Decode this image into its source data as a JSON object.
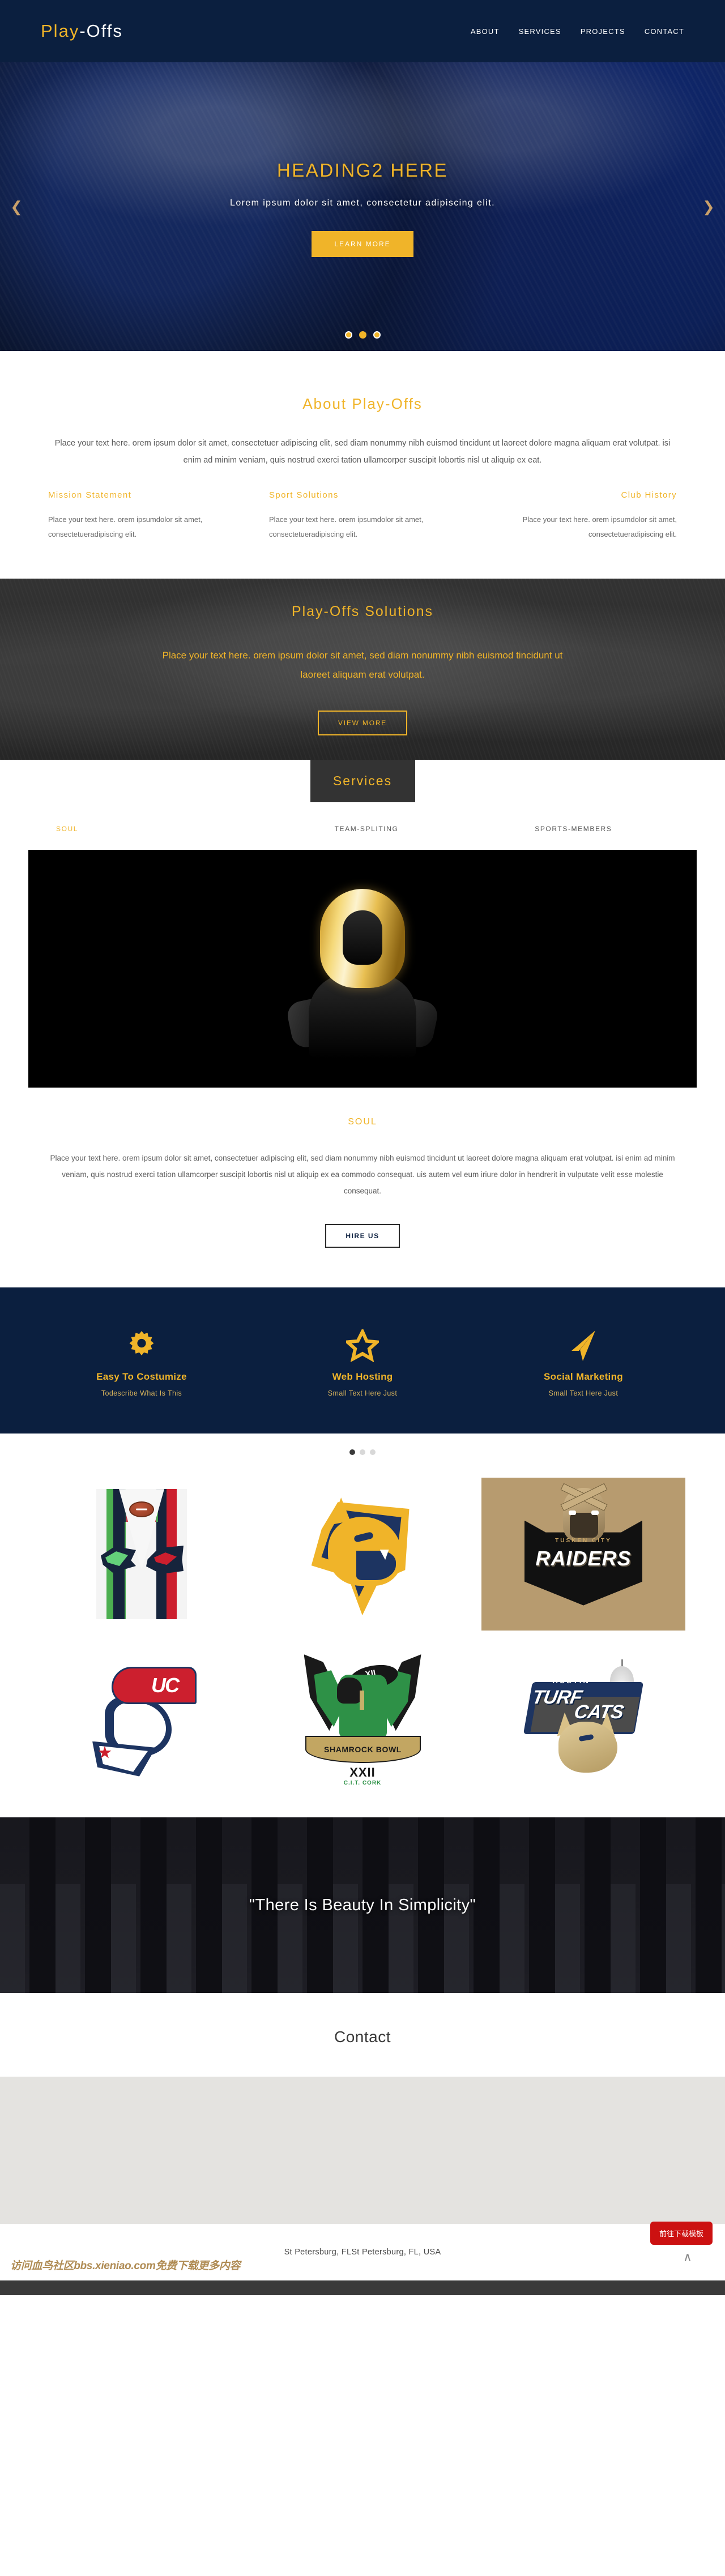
{
  "header": {
    "brand_first": "Play",
    "brand_second": "-Offs",
    "nav": [
      {
        "label": "ABOUT"
      },
      {
        "label": "SERVICES"
      },
      {
        "label": "PROJECTS"
      },
      {
        "label": "CONTACT"
      }
    ]
  },
  "hero": {
    "title": "HEADING2 HERE",
    "subtitle": "Lorem ipsum dolor sit amet, consectetur adipiscing elit.",
    "cta": "LEARN MORE",
    "prev_icon": "chevron-left-icon",
    "next_icon": "chevron-right-icon",
    "dots": [
      {
        "active": false
      },
      {
        "active": true
      },
      {
        "active": false
      }
    ]
  },
  "about": {
    "title": "About Play-Offs",
    "body": "Place your text here. orem ipsum dolor sit amet, consectetuer adipiscing elit, sed diam nonummy nibh euismod tincidunt ut laoreet dolore magna aliquam erat volutpat. isi enim ad minim veniam, quis nostrud exerci tation ullamcorper suscipit lobortis nisl ut aliquip ex eat.",
    "columns": [
      {
        "title": "Mission Statement",
        "text": "Place your text here. orem ipsumdolor sit amet, consectetueradipiscing elit."
      },
      {
        "title": "Sport Solutions",
        "text": "Place your text here. orem ipsumdolor sit amet, consectetueradipiscing elit."
      },
      {
        "title": "Club History",
        "text": "Place your text here. orem ipsumdolor sit amet, consectetueradipiscing elit."
      }
    ]
  },
  "solutions": {
    "title": "Play-Offs Solutions",
    "text": "Place your text here. orem ipsum dolor sit amet, sed diam nonummy nibh euismod tincidunt ut laoreet aliquam erat volutpat.",
    "cta": "VIEW MORE"
  },
  "services": {
    "section_title": "Services",
    "tabs": [
      {
        "label": "SOUL",
        "active": true
      },
      {
        "label": "TEAM-SPLITING",
        "active": false
      },
      {
        "label": "SPORTS-MEMBERS",
        "active": false
      }
    ],
    "panel_title": "SOUL",
    "panel_body": "Place your text here. orem ipsum dolor sit amet, consectetuer adipiscing elit, sed diam nonummy nibh euismod tincidunt ut laoreet dolore magna aliquam erat volutpat. isi enim ad minim veniam, quis nostrud exerci tation ullamcorper suscipit lobortis nisl ut aliquip ex ea commodo consequat. uis autem vel eum iriure dolor in hendrerit in vulputate velit esse molestie consequat.",
    "cta": "HIRE US"
  },
  "features": [
    {
      "icon": "gear-icon",
      "title": "Easy To Costumize",
      "subtitle": "Todescribe What Is This"
    },
    {
      "icon": "star-icon",
      "title": "Web Hosting",
      "subtitle": "Small Text Here Just"
    },
    {
      "icon": "paper-plane-icon",
      "title": "Social Marketing",
      "subtitle": "Small Text Here Just"
    }
  ],
  "gallery": {
    "dots": [
      {
        "active": true
      },
      {
        "active": false
      },
      {
        "active": false
      }
    ],
    "logos": [
      {
        "name": "seahawks-vs-patriots-logo",
        "caption": ""
      },
      {
        "name": "wildcat-logo",
        "caption": ""
      },
      {
        "name": "tusken-city-raiders-logo",
        "caption_top": "TUSKEN CITY",
        "caption_main": "RAIDERS"
      },
      {
        "name": "uc-colonial-logo",
        "caption": "UC"
      },
      {
        "name": "shamrock-bowl-logo",
        "banner": "SHAMROCK BOWL",
        "numeral": "XXII",
        "sub": "C.I.T. CORK",
        "ring": "XII"
      },
      {
        "name": "austin-turfcats-logo",
        "city": "AUSTIN",
        "word1": "TURF",
        "word2": "CATS"
      }
    ]
  },
  "quote": {
    "text": "\"There Is Beauty In Simplicity\""
  },
  "contact": {
    "title": "Contact"
  },
  "footer": {
    "address": "St Petersburg, FLSt Petersburg, FL, USA",
    "watermark": "访问血鸟社区bbs.xieniao.com免费下载更多内容",
    "download_button": "前往下载模板",
    "back_to_top_icon": "chevron-up-icon"
  },
  "colors": {
    "navy": "#0b1f3f",
    "gold": "#f0b429",
    "dark": "#333333",
    "red": "#cc1111"
  }
}
